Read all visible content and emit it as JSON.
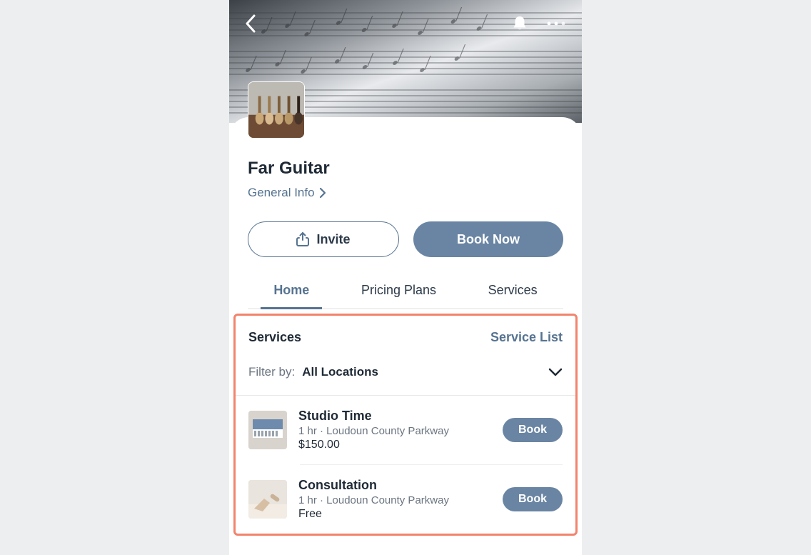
{
  "business": {
    "name": "Far Guitar",
    "general_info_label": "General Info"
  },
  "actions": {
    "invite_label": "Invite",
    "book_now_label": "Book Now"
  },
  "tabs": [
    {
      "label": "Home",
      "active": true
    },
    {
      "label": "Pricing Plans",
      "active": false
    },
    {
      "label": "Services",
      "active": false
    }
  ],
  "services_section": {
    "heading": "Services",
    "link_label": "Service List",
    "filter_label": "Filter by:",
    "filter_value": "All Locations"
  },
  "services": [
    {
      "title": "Studio Time",
      "meta": "1 hr · Loudoun County Parkway",
      "price": "$150.00",
      "book_label": "Book"
    },
    {
      "title": "Consultation",
      "meta": "1 hr · Loudoun County Parkway",
      "price": "Free",
      "book_label": "Book"
    }
  ]
}
